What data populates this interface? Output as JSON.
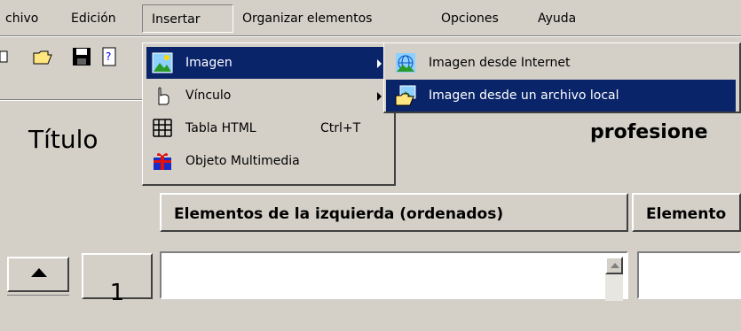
{
  "menubar": {
    "items": [
      "chivo",
      "Edición",
      "Insertar",
      "Organizar elementos",
      "Opciones",
      "Ayuda"
    ]
  },
  "main": {
    "title_label": "Título",
    "title_value_partial": "profesione",
    "left_column_header": "Elementos de la izquierda (ordenados)",
    "right_column_header_partial": "Elemento",
    "row_number": "1"
  },
  "insert_menu": {
    "items": [
      {
        "label": "Imagen",
        "icon": "image-icon",
        "submenu": true,
        "highlighted": true
      },
      {
        "label": "Vínculo",
        "icon": "hand-link-icon",
        "submenu": true
      },
      {
        "label": "Tabla HTML",
        "icon": "table-grid-icon",
        "shortcut": "Ctrl+T"
      },
      {
        "label": "Objeto Multimedia",
        "icon": "gift-box-icon"
      }
    ]
  },
  "image_submenu": {
    "items": [
      {
        "label": "Imagen desde Internet",
        "icon": "internet-image-icon"
      },
      {
        "label": "Imagen desde un archivo local",
        "icon": "folder-image-icon",
        "highlighted": true
      }
    ]
  },
  "colors": {
    "highlight": "#0a246a",
    "face": "#d4d0c8"
  }
}
